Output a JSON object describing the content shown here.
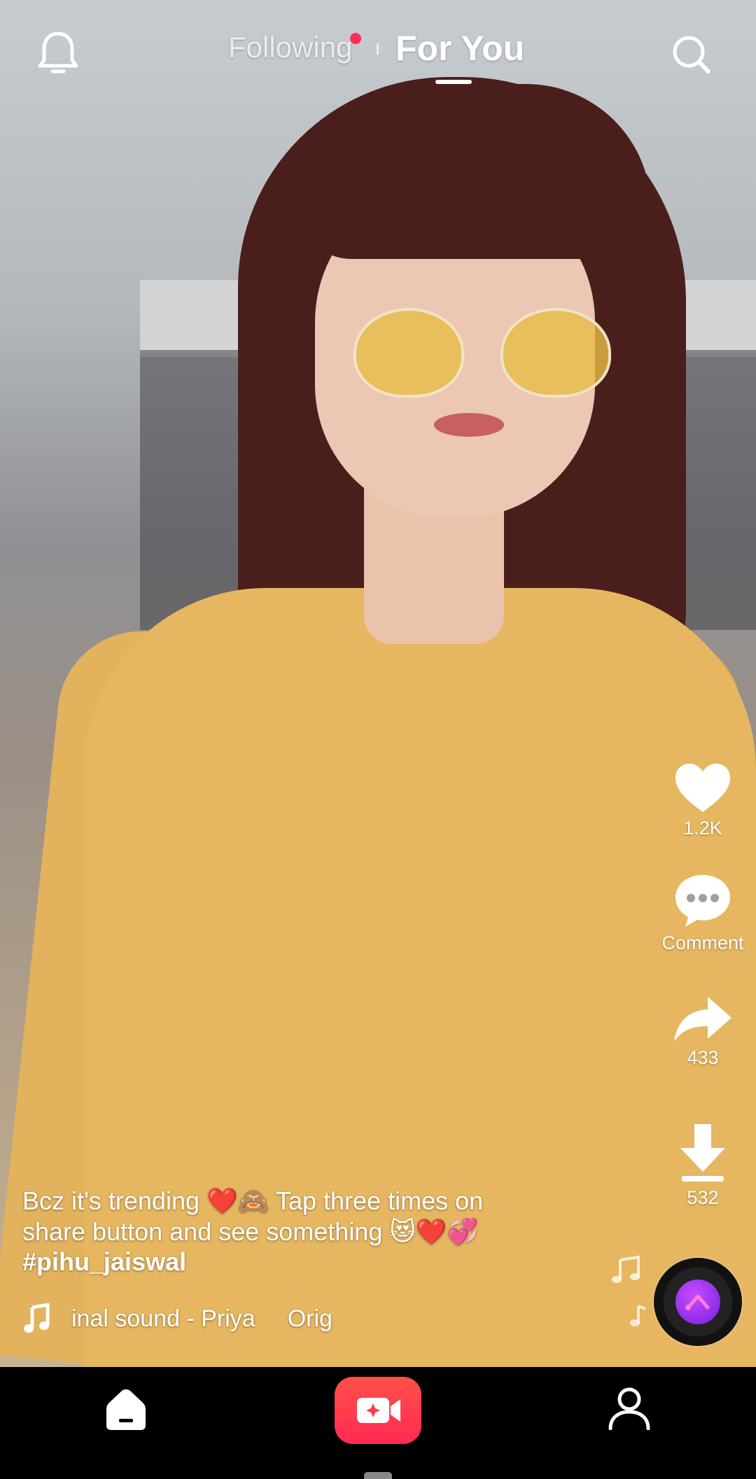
{
  "header": {
    "following_label": "Following",
    "for_you_label": "For You"
  },
  "actions": {
    "likes_count": "1.2K",
    "comment_label": "Comment",
    "shares_count": "433",
    "downloads_count": "532"
  },
  "post": {
    "caption": "Bcz it's trending ❤️🙈 Tap three times on share button and see something 😻❤️💞",
    "hashtag": "#pihu_jaiswal",
    "music_part_1": "inal sound - Priya",
    "music_part_2": "Orig"
  },
  "colors": {
    "accent_red": "#ff2d55",
    "record_button": "#ff3b4f",
    "disc_center": "#a63cf5"
  },
  "icons": {
    "bell": "bell-icon",
    "search": "search-icon",
    "like": "heart-icon",
    "comment": "comment-bubble-icon",
    "share": "share-arrow-icon",
    "download": "download-icon",
    "music": "music-note-icon",
    "home": "home-icon",
    "record": "video-camera-icon",
    "profile": "person-icon"
  }
}
